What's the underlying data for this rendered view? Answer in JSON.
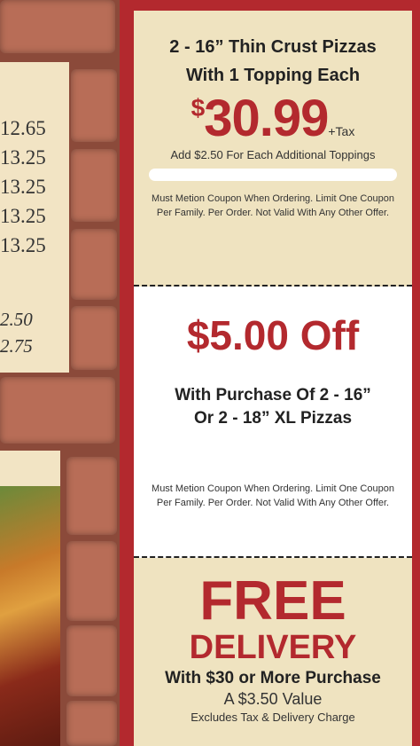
{
  "menu": {
    "prices": [
      "12.65",
      "13.25",
      "13.25",
      "13.25",
      "13.25"
    ],
    "prices_italic": [
      "2.50",
      "2.75"
    ]
  },
  "coupons": [
    {
      "title_line1": "2 - 16” Thin Crust Pizzas",
      "title_line2": "With 1 Topping Each",
      "price_symbol": "$",
      "price_value": "30.99",
      "price_suffix": "+Tax",
      "extra": "Add $2.50 For Each Additional Toppings",
      "fine_line1": "Must Metion Coupon When Ordering.  Limit One Coupon",
      "fine_line2": "Per Family. Per Order. Not Valid With Any Other Offer."
    },
    {
      "headline": "$5.00 Off",
      "line1": "With Purchase Of 2 - 16”",
      "line2": "Or 2 - 18” XL Pizzas",
      "fine_line1": "Must Metion Coupon When Ordering.  Limit One Coupon",
      "fine_line2": "Per Family. Per Order. Not Valid With Any Other Offer."
    },
    {
      "headline1": "FREE",
      "headline2": "DELIVERY",
      "line1": "With $30 or More Purchase",
      "line2": "A $3.50 Value",
      "line3": "Excludes Tax & Delivery Charge"
    }
  ]
}
